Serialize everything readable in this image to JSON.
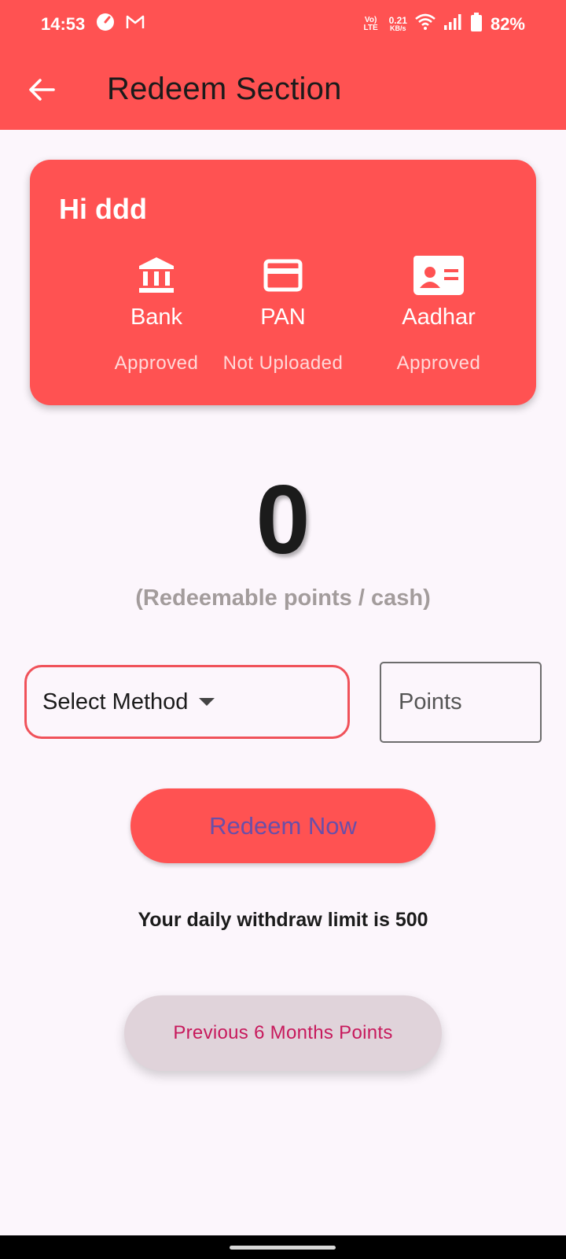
{
  "status_bar": {
    "time": "14:53",
    "net_type": "Vo) LTE",
    "net_speed_value": "0.21",
    "net_speed_unit": "KB/s",
    "battery_percent": "82%"
  },
  "app_bar": {
    "title": "Redeem Section"
  },
  "kyc_card": {
    "greeting": "Hi ddd",
    "items": [
      {
        "label": "Bank",
        "status": "Approved",
        "icon": "bank-icon"
      },
      {
        "label": "PAN",
        "status": "Not Uploaded",
        "icon": "card-icon"
      },
      {
        "label": "Aadhar",
        "status": "Approved",
        "icon": "id-card-icon"
      }
    ]
  },
  "balance": {
    "value": "0",
    "caption": "(Redeemable points / cash)"
  },
  "form": {
    "method_select_label": "Select Method",
    "points_placeholder": "Points"
  },
  "actions": {
    "redeem_label": "Redeem Now",
    "limit_text": "Your daily withdraw limit is 500",
    "previous_label": "Previous 6 Months Points"
  },
  "colors": {
    "primary": "#ff5252",
    "background": "#fcf6fc",
    "redeem_text": "#6a4fa8",
    "previous_text": "#c7195c"
  }
}
